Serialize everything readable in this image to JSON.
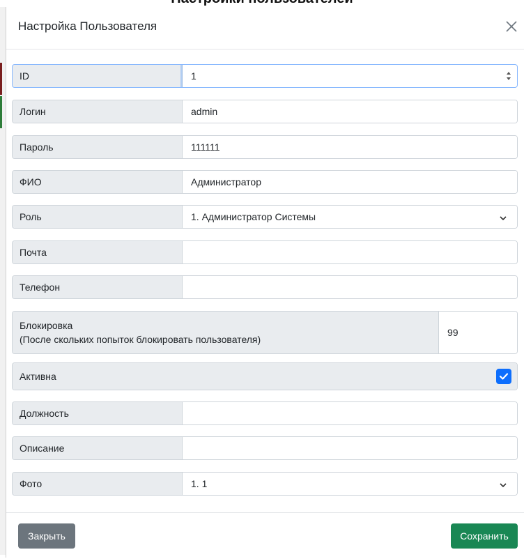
{
  "background": {
    "heading": "Настройки пользователей"
  },
  "modal": {
    "title": "Настройка Пользователя",
    "fields": {
      "id": {
        "label": "ID",
        "value": "1"
      },
      "login": {
        "label": "Логин",
        "value": "admin"
      },
      "password": {
        "label": "Пароль",
        "value": "111111"
      },
      "fio": {
        "label": "ФИО",
        "value": "Администратор"
      },
      "role": {
        "label": "Роль",
        "value": "1. Администратор Системы"
      },
      "email": {
        "label": "Почта",
        "value": ""
      },
      "phone": {
        "label": "Телефон",
        "value": ""
      },
      "block": {
        "label": "Блокировка",
        "sublabel": "(После скольких попыток блокировать пользователя)",
        "value": "99"
      },
      "active": {
        "label": "Активна",
        "checked": true
      },
      "position": {
        "label": "Должность",
        "value": ""
      },
      "description": {
        "label": "Описание",
        "value": ""
      },
      "photo": {
        "label": "Фото",
        "value": "1. 1"
      }
    },
    "footer": {
      "close_label": "Закрыть",
      "save_label": "Сохранить"
    }
  },
  "colors": {
    "primary": "#0d6efd",
    "secondary": "#6c757d",
    "success": "#198754",
    "label_bg": "#e9ecef",
    "border": "#ced4da"
  },
  "icons": {
    "close": "close-icon",
    "spinner": "spinner-arrows-icon",
    "dropdown": "chevron-down-icon",
    "check": "check-icon"
  }
}
